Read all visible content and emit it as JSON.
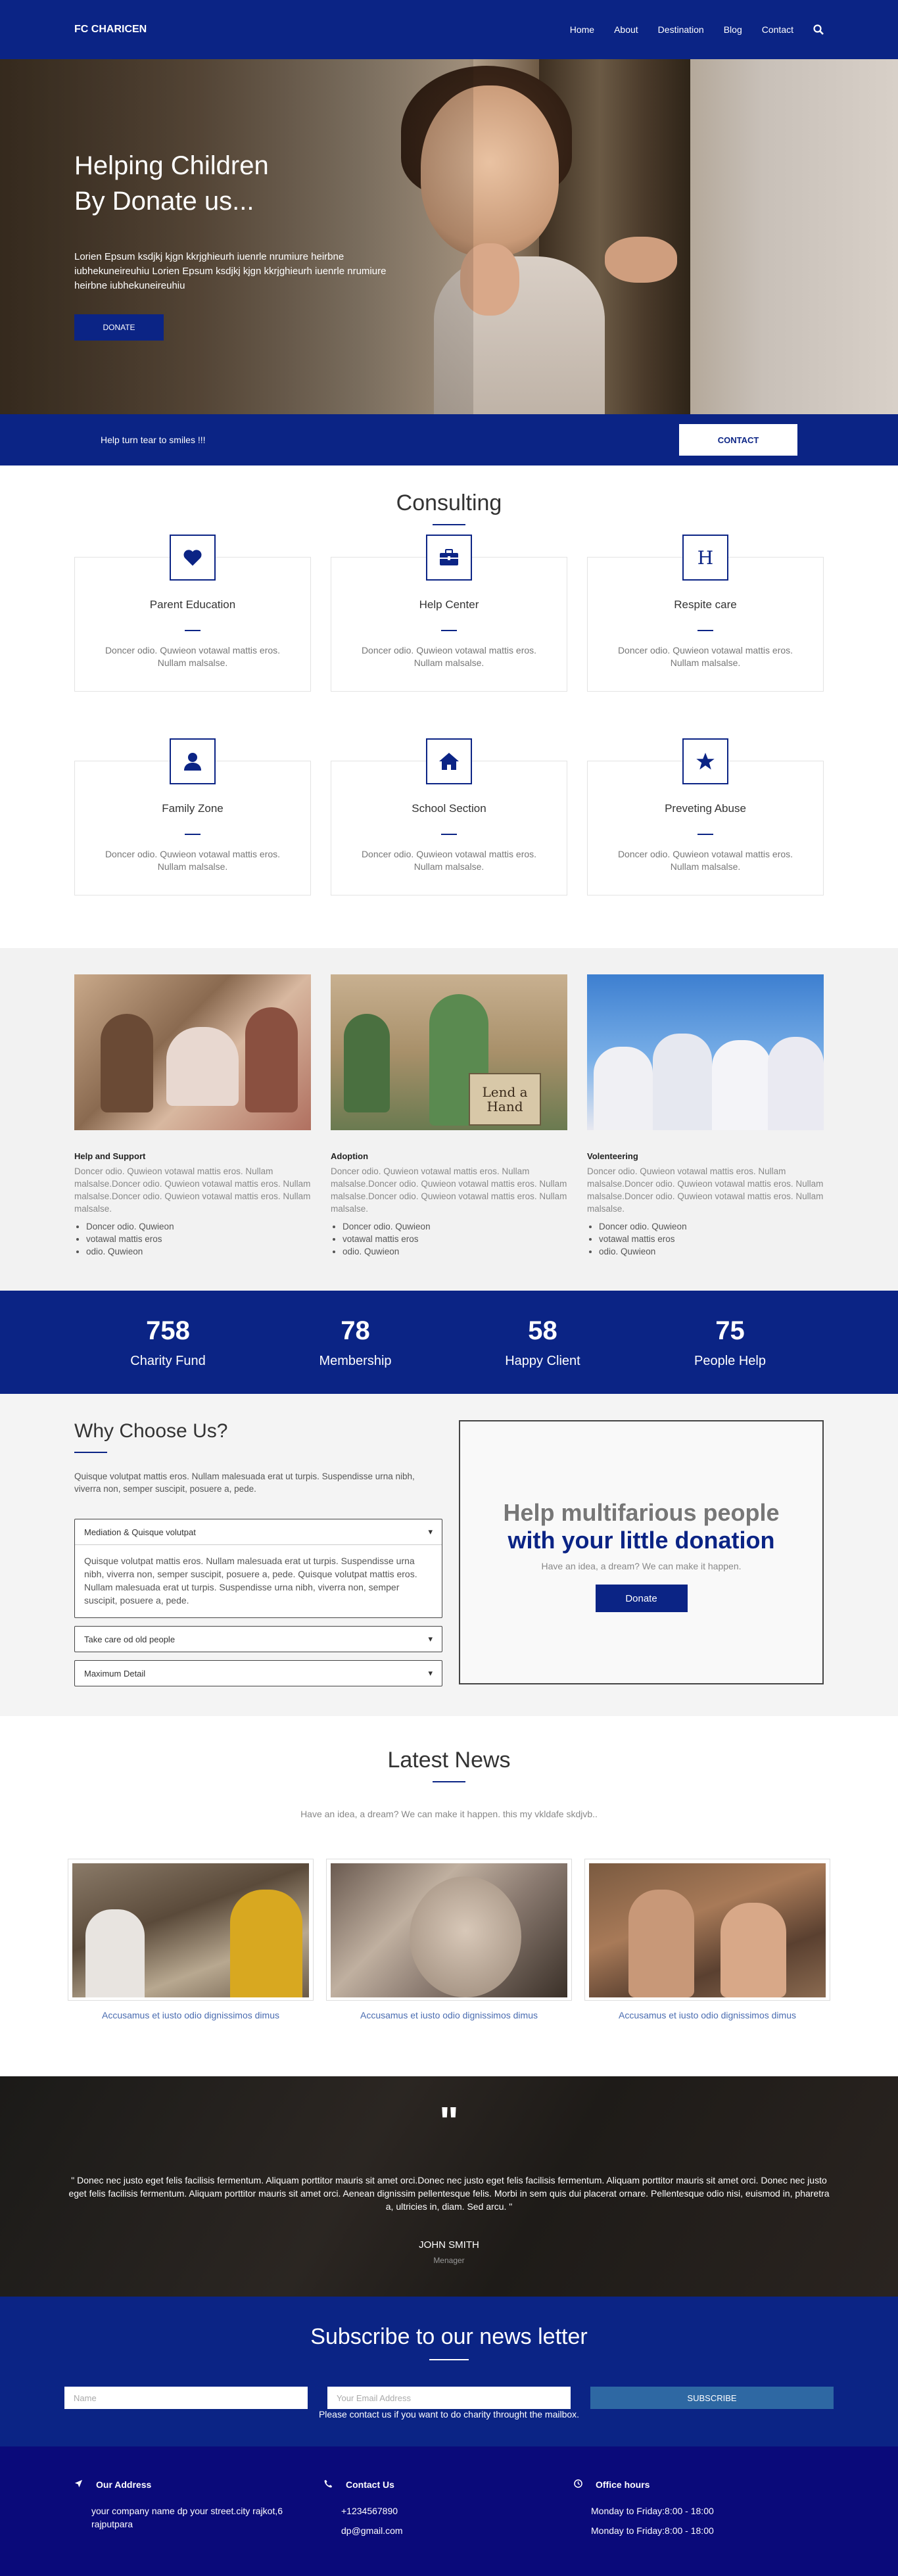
{
  "nav": {
    "brand": "FC CHARICEN",
    "items": [
      "Home",
      "About",
      "Destination",
      "Blog",
      "Contact"
    ]
  },
  "hero": {
    "title_line1": "Helping Children",
    "title_line2": "By Donate us...",
    "text": "Lorien Epsum ksdjkj kjgn kkrjghieurh iuenrle nrumiure heirbne iubhekuneireuhiu Lorien Epsum ksdjkj kjgn kkrjghieurh iuenrle nrumiure heirbne iubhekuneireuhiu",
    "button": "DONATE"
  },
  "cta": {
    "text": "Help turn tear to smiles !!!",
    "button": "CONTACT"
  },
  "consulting": {
    "title": "Consulting",
    "cards": [
      {
        "title": "Parent Education",
        "icon": "heart-icon",
        "text": "Doncer odio. Quwieon votawal mattis eros. Nullam malsalse."
      },
      {
        "title": "Help Center",
        "icon": "briefcase-icon",
        "text": "Doncer odio. Quwieon votawal mattis eros. Nullam malsalse."
      },
      {
        "title": "Respite care",
        "icon": "hospital-h-icon",
        "text": "Doncer odio. Quwieon votawal mattis eros. Nullam malsalse."
      },
      {
        "title": "Family Zone",
        "icon": "user-icon",
        "text": "Doncer odio. Quwieon votawal mattis eros. Nullam malsalse."
      },
      {
        "title": "School Section",
        "icon": "home-icon",
        "text": "Doncer odio. Quwieon votawal mattis eros. Nullam malsalse."
      },
      {
        "title": "Preveting Abuse",
        "icon": "star-icon",
        "text": "Doncer odio. Quwieon votawal mattis eros. Nullam malsalse."
      }
    ]
  },
  "help": [
    {
      "title": "Help and Support",
      "text": "Doncer odio. Quwieon votawal mattis eros. Nullam malsalse.Doncer odio. Quwieon votawal mattis eros. Nullam malsalse.Doncer odio. Quwieon votawal mattis eros. Nullam malsalse.",
      "bullets": [
        "Doncer odio. Quwieon",
        "votawal mattis eros",
        "odio. Quwieon"
      ],
      "sign": ""
    },
    {
      "title": "Adoption",
      "text": "Doncer odio. Quwieon votawal mattis eros. Nullam malsalse.Doncer odio. Quwieon votawal mattis eros. Nullam malsalse.Doncer odio. Quwieon votawal mattis eros. Nullam malsalse.",
      "bullets": [
        "Doncer odio. Quwieon",
        "votawal mattis eros",
        "odio. Quwieon"
      ],
      "sign": "Lend a Hand"
    },
    {
      "title": "Volenteering",
      "text": "Doncer odio. Quwieon votawal mattis eros. Nullam malsalse.Doncer odio. Quwieon votawal mattis eros. Nullam malsalse.Doncer odio. Quwieon votawal mattis eros. Nullam malsalse.",
      "bullets": [
        "Doncer odio. Quwieon",
        "votawal mattis eros",
        "odio. Quwieon"
      ],
      "sign": ""
    }
  ],
  "stats": [
    {
      "value": "758",
      "label": "Charity Fund"
    },
    {
      "value": "78",
      "label": "Membership"
    },
    {
      "value": "58",
      "label": "Happy Client"
    },
    {
      "value": "75",
      "label": "People Help"
    }
  ],
  "why": {
    "title": "Why Choose Us?",
    "lead": "Quisque volutpat mattis eros. Nullam malesuada erat ut turpis. Suspendisse urna nibh, viverra non, semper suscipit, posuere a, pede.",
    "accordion": [
      {
        "label": "Mediation & Quisque volutpat",
        "body": "Quisque volutpat mattis eros. Nullam malesuada erat ut turpis. Suspendisse urna nibh, viverra non, semper suscipit, posuere a, pede. Quisque volutpat mattis eros. Nullam malesuada erat ut turpis. Suspendisse urna nibh, viverra non, semper suscipit, posuere a, pede."
      },
      {
        "label": "Take care od old people",
        "body": ""
      },
      {
        "label": "Maximum Detail",
        "body": ""
      }
    ],
    "box_line1": "Help multifarious people",
    "box_line2": "with your little donation",
    "box_sub": "Have an idea, a dream? We can make it happen.",
    "box_button": "Donate"
  },
  "news": {
    "title": "Latest News",
    "sub": "Have an idea, a dream? We can make it happen. this my vkldafe skdjvb..",
    "items": [
      "Accusamus et iusto odio dignissimos dimus",
      "Accusamus et iusto odio dignissimos dimus",
      "Accusamus et iusto odio dignissimos dimus"
    ]
  },
  "testimonial": {
    "quote_mark": "\"",
    "text": "\" Donec nec justo eget felis facilisis fermentum. Aliquam porttitor mauris sit amet orci.Donec nec justo eget felis facilisis fermentum. Aliquam porttitor mauris sit amet orci. Donec nec justo eget felis facilisis fermentum. Aliquam porttitor mauris sit amet orci. Aenean dignissim pellentesque felis. Morbi in sem quis dui placerat ornare. Pellentesque odio nisi, euismod in, pharetra a, ultricies in, diam. Sed arcu. \"",
    "name": "JOHN SMITH",
    "role": "Menager"
  },
  "subscribe": {
    "title": "Subscribe to our news letter",
    "name_placeholder": "Name",
    "email_placeholder": "Your Email Address",
    "button": "SUBSCRIBE",
    "note": "Please contact us if you want to do charity throught the mailbox."
  },
  "footer": {
    "address_title": "Our Address",
    "address_line1": "your company name dp your street.city rajkot,6",
    "address_line2": "rajputpara",
    "contact_title": "Contact Us",
    "phone": "+1234567890",
    "email": "dp@gmail.com",
    "hours_title": "Office hours",
    "hours1": "Monday to Friday:8:00 - 18:00",
    "hours2": "Monday to Friday:8:00 - 18:00"
  },
  "colors": {
    "primary": "#0b2485",
    "footer": "#0a0a7a",
    "subscribe_button": "#2e68a3"
  }
}
